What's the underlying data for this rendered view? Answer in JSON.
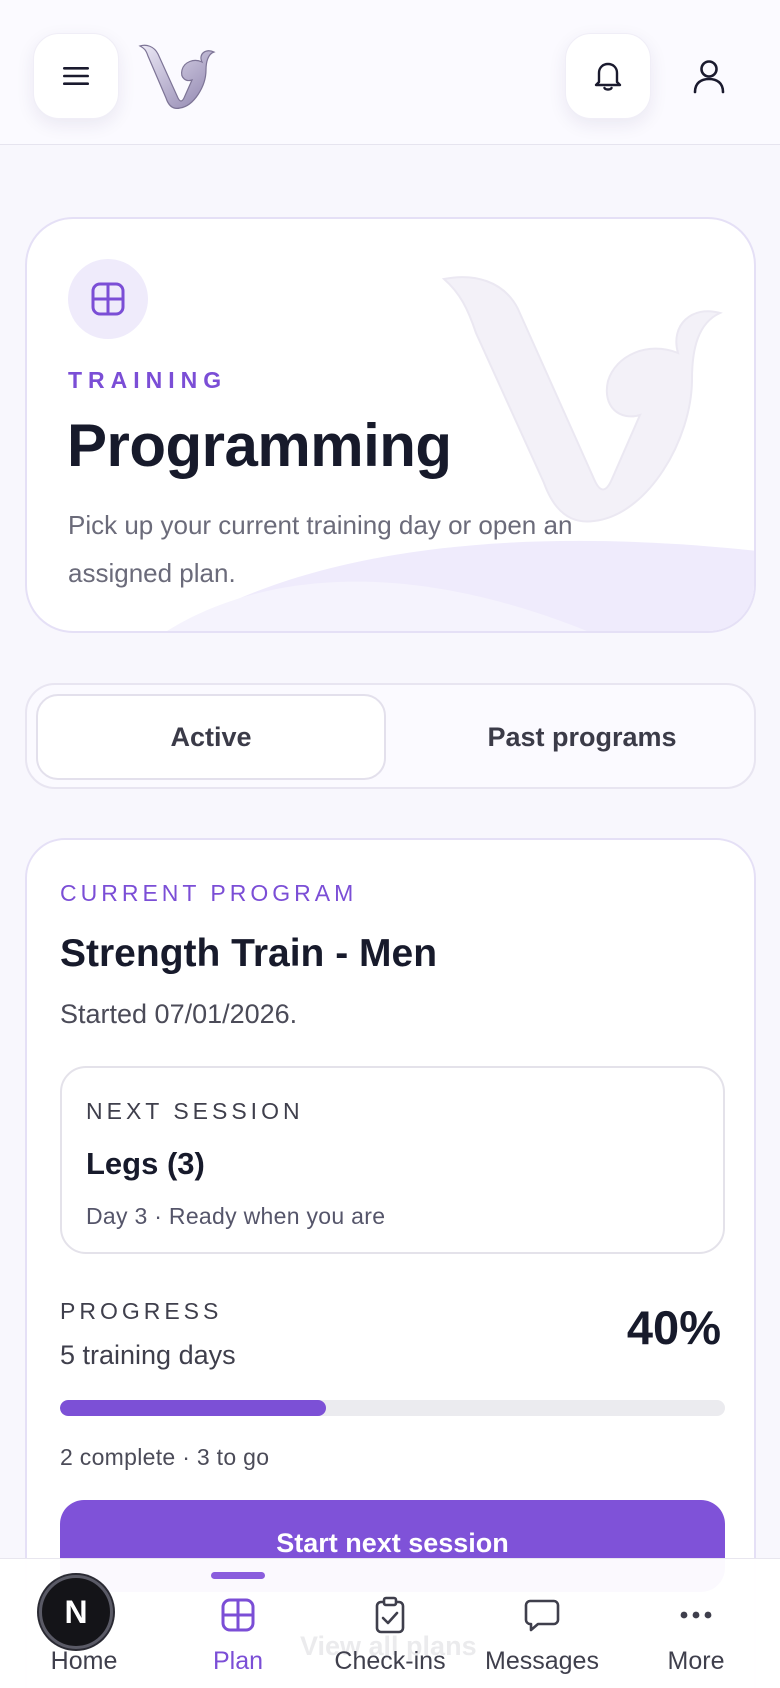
{
  "header": {
    "menu_icon": "hamburger-menu-icon",
    "logo": "brand-v-logo",
    "bell_icon": "bell-icon",
    "profile_icon": "user-icon"
  },
  "hero": {
    "icon": "grid-icon",
    "eyebrow": "TRAINING",
    "title": "Programming",
    "subtitle": "Pick up your current training day or open an assigned plan."
  },
  "tabs": [
    {
      "label": "Active",
      "selected": true
    },
    {
      "label": "Past programs",
      "selected": false
    }
  ],
  "program": {
    "eyebrow": "CURRENT PROGRAM",
    "title": "Strength Train - Men",
    "started": "Started 07/01/2026.",
    "next_session": {
      "eyebrow": "NEXT SESSION",
      "title": "Legs (3)",
      "subtitle": "Day 3 · Ready when you are"
    },
    "progress": {
      "label": "PROGRESS",
      "days": "5 training days",
      "percent_text": "40%",
      "fraction": 0.4,
      "footer": "2 complete · 3 to go"
    },
    "cta": "Start next session"
  },
  "bottom_nav": {
    "ghost_text": "View all plans",
    "badge": "N",
    "items": [
      {
        "label": "Home",
        "icon": "home-icon"
      },
      {
        "label": "Plan",
        "icon": "grid-icon",
        "active": true
      },
      {
        "label": "Check-ins",
        "icon": "clipboard-check-icon"
      },
      {
        "label": "Messages",
        "icon": "chat-bubble-icon"
      },
      {
        "label": "More",
        "icon": "more-dots-icon"
      }
    ]
  },
  "colors": {
    "accent": "#7c50d6",
    "text": "#171a2b",
    "muted": "#6b6b7a",
    "background": "#f8f7fd"
  }
}
